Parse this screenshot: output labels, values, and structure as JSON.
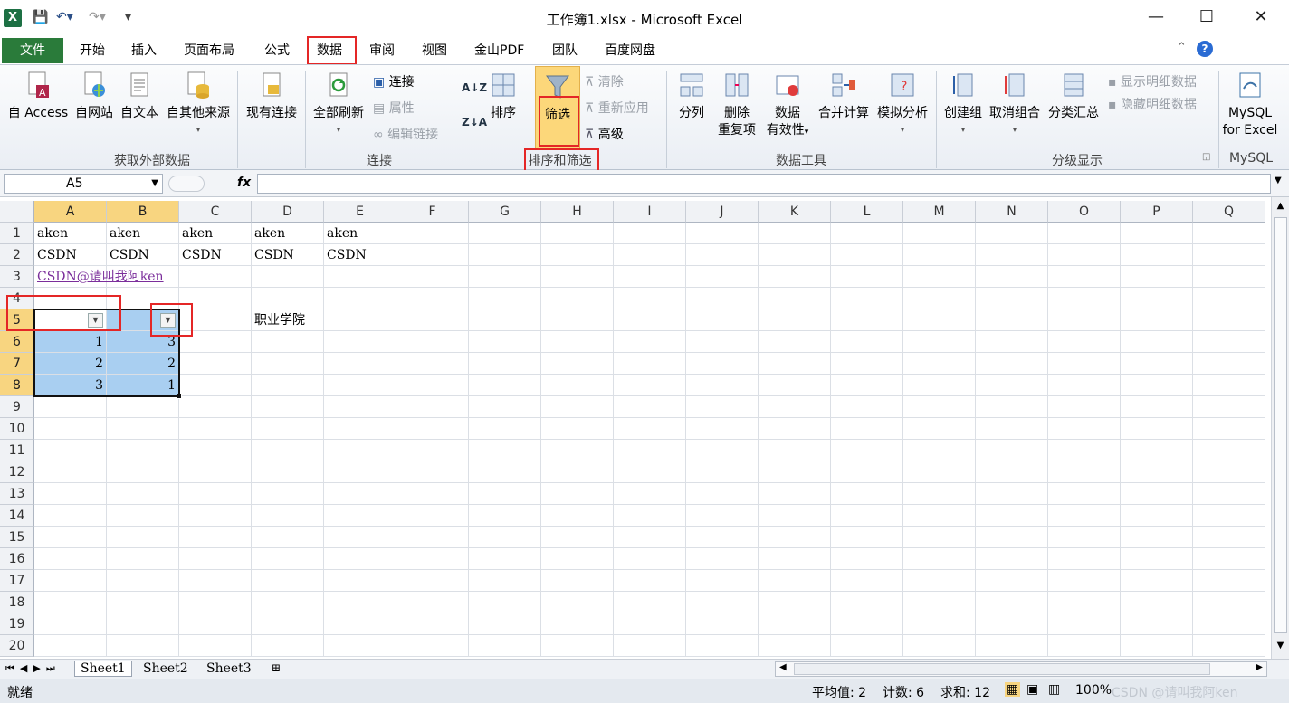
{
  "title_bar": {
    "title": "工作簿1.xlsx - Microsoft Excel",
    "minimize": "—",
    "maximize": "☐",
    "close": "✕",
    "app_icon": "X"
  },
  "quick_access": {
    "save": "💾",
    "undo": "↶▾",
    "redo": "↷▾",
    "customize": "▾"
  },
  "tabs": [
    "文件",
    "开始",
    "插入",
    "页面布局",
    "公式",
    "数据",
    "审阅",
    "视图",
    "金山PDF",
    "团队",
    "百度网盘"
  ],
  "active_tab": "数据",
  "help_icons": {
    "caret": "⌃",
    "help": "?"
  },
  "ribbon": {
    "get_external": {
      "access": "自 Access",
      "web": "自网站",
      "text": "自文本",
      "other": "自其他来源",
      "existing": "现有连接",
      "label": "获取外部数据"
    },
    "connections": {
      "refresh_all": "全部刷新",
      "connections": "连接",
      "properties": "属性",
      "edit_links": "编辑链接",
      "label": "连接"
    },
    "sort_filter": {
      "sort_az": "A↓Z",
      "sort_za": "Z↓A",
      "sort": "排序",
      "filter": "筛选",
      "clear": "清除",
      "reapply": "重新应用",
      "advanced": "高级",
      "label": "排序和筛选"
    },
    "data_tools": {
      "text_to_columns": "分列",
      "remove_dup_1": "删除",
      "remove_dup_2": "重复项",
      "validation_1": "数据",
      "validation_2": "有效性",
      "consolidate": "合并计算",
      "whatif": "模拟分析",
      "label": "数据工具"
    },
    "outline": {
      "group": "创建组",
      "ungroup": "取消组合",
      "subtotal": "分类汇总",
      "show_detail": "显示明细数据",
      "hide_detail": "隐藏明细数据",
      "label": "分级显示"
    },
    "mysql": {
      "button_1": "MySQL",
      "button_2": "for Excel",
      "label": "MySQL"
    }
  },
  "formula_bar": {
    "name_box": "A5",
    "fx": "fx",
    "formula": ""
  },
  "columns": [
    "A",
    "B",
    "C",
    "D",
    "E",
    "F",
    "G",
    "H",
    "I",
    "J",
    "K",
    "L",
    "M",
    "N",
    "O",
    "P",
    "Q"
  ],
  "rows": [
    "1",
    "2",
    "3",
    "4",
    "5",
    "6",
    "7",
    "8",
    "9",
    "10",
    "11",
    "12",
    "13",
    "14",
    "15",
    "16",
    "17",
    "18",
    "19",
    "20"
  ],
  "cells": {
    "A1": "aken",
    "B1": "aken",
    "C1": "aken",
    "D1": "aken",
    "E1": "aken",
    "A2": "CSDN",
    "B2": "CSDN",
    "C2": "CSDN",
    "D2": "CSDN",
    "E2": "CSDN",
    "A3": "CSDN@请叫我阿ken",
    "D5": "职业学院",
    "A6": "1",
    "B6": "3",
    "A7": "2",
    "B7": "2",
    "A8": "3",
    "B8": "1"
  },
  "sheets": [
    "Sheet1",
    "Sheet2",
    "Sheet3"
  ],
  "status": {
    "mode": "就绪",
    "average": "平均值: 2",
    "count": "计数: 6",
    "sum": "求和: 12",
    "zoom": "100%",
    "watermark": "CSDN @请叫我阿ken"
  }
}
